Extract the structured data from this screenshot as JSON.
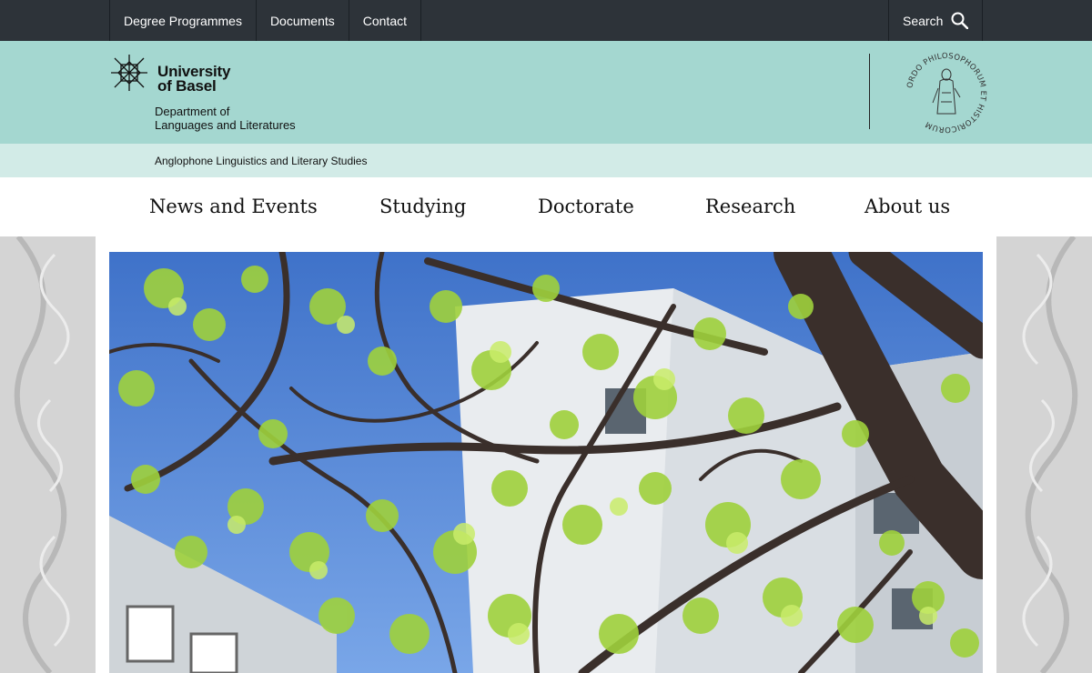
{
  "topbar": {
    "links": [
      "Degree Programmes",
      "Documents",
      "Contact"
    ],
    "search_label": "Search"
  },
  "header": {
    "logo_line1": "University",
    "logo_line2": "of Basel",
    "dept_line1": "Department of",
    "dept_line2": "Languages and Literatures",
    "seal_text": "ORDO PHILOSOPHORUM ET HISTORICORUM"
  },
  "subheader": {
    "text": "Anglophone Linguistics and Literary Studies"
  },
  "mainnav": {
    "items": [
      "News and Events",
      "Studying",
      "Doctorate",
      "Research",
      "About us"
    ]
  },
  "colors": {
    "topbar": "#2d3339",
    "header": "#a4d7d0",
    "subheader": "#d2ebe7"
  },
  "icons": {
    "search": "search-icon",
    "logo": "university-logo-icon",
    "seal": "faculty-seal-icon"
  },
  "hero": {
    "image": "tree-branches-courtyard-photo"
  }
}
